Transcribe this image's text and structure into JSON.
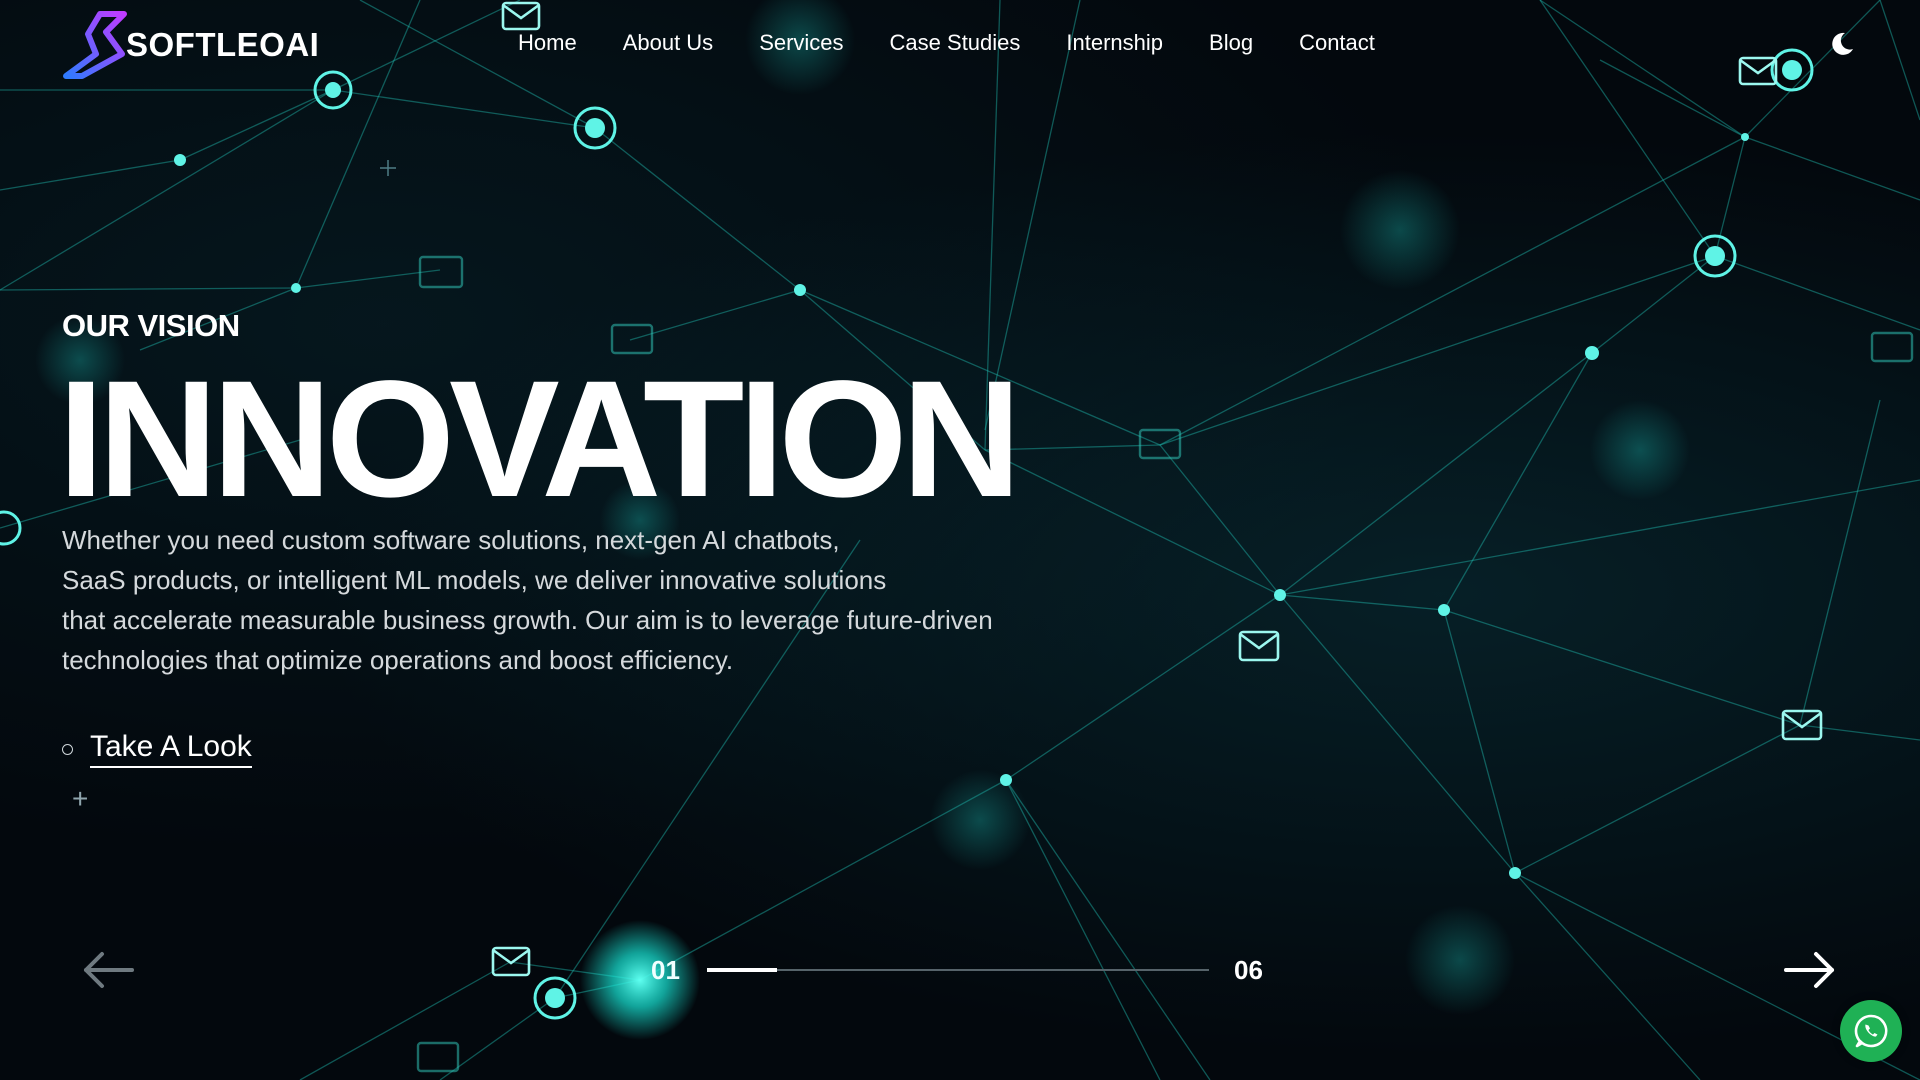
{
  "brand": {
    "name": "SOFTLEOAI",
    "logo_gradient": [
      "#2f7bff",
      "#c13bff"
    ]
  },
  "nav": {
    "items": [
      {
        "label": "Home"
      },
      {
        "label": "About Us"
      },
      {
        "label": "Services"
      },
      {
        "label": "Case Studies"
      },
      {
        "label": "Internship"
      },
      {
        "label": "Blog"
      },
      {
        "label": "Contact"
      }
    ],
    "theme_toggle_icon": "moon-icon"
  },
  "hero": {
    "eyebrow": "OUR VISION",
    "headline": "INNOVATION",
    "description": [
      "Whether you need custom software solutions, next-gen AI chatbots,",
      "SaaS products, or intelligent ML models, we deliver innovative solutions",
      "that accelerate measurable business growth. Our aim is to leverage future-driven",
      "technologies that optimize operations and boost efficiency."
    ],
    "cta_label": "Take A Look"
  },
  "slider": {
    "current": "01",
    "total": "06",
    "progress": 0.14,
    "prev_icon": "arrow-left-icon",
    "next_icon": "arrow-right-icon"
  },
  "whatsapp_icon": "whatsapp-icon",
  "colors": {
    "accent": "#18e6d6",
    "background": "#03080d",
    "whatsapp": "#1fb155"
  }
}
